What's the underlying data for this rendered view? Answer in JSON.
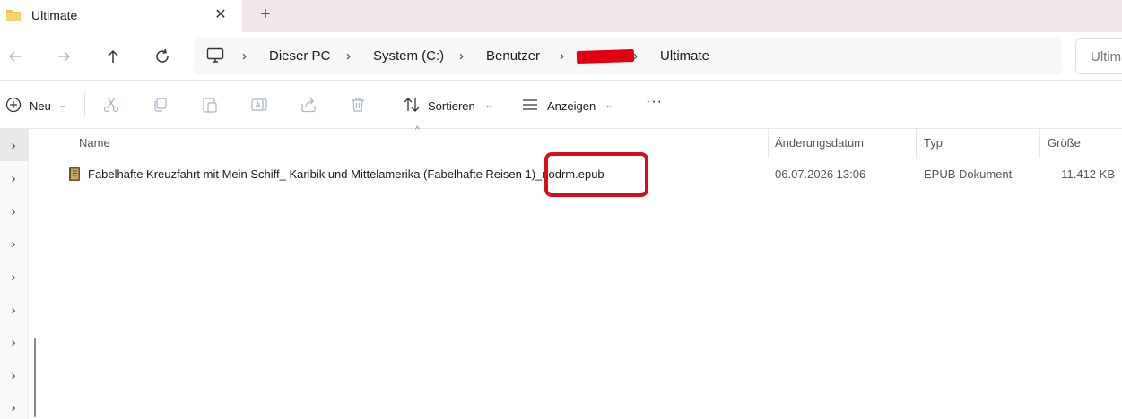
{
  "tab": {
    "title": "Ultimate",
    "close_glyph": "✕",
    "new_tab_glyph": "+"
  },
  "nav": {
    "back_icon": "arrow-left-icon",
    "forward_icon": "arrow-right-icon",
    "up_icon": "arrow-up-icon",
    "refresh_icon": "refresh-icon"
  },
  "breadcrumb": {
    "root_icon": "monitor-icon",
    "separator": "›",
    "items": [
      "Dieser PC",
      "System (C:)",
      "Benutzer",
      "",
      "Ultimate"
    ]
  },
  "search": {
    "placeholder": "Ultimate"
  },
  "toolbar": {
    "new_label": "Neu",
    "sort_label": "Sortieren",
    "view_label": "Anzeigen",
    "more_glyph": "···",
    "caret": "⌄"
  },
  "navpane": {
    "chevron": "›"
  },
  "columns": {
    "name": "Name",
    "date": "Änderungsdatum",
    "type": "Typ",
    "size": "Größe",
    "sort_indicator": "^"
  },
  "files": [
    {
      "name": "Fabelhafte Kreuzfahrt mit Mein Schiff_ Karibik und Mittelamerika (Fabelhafte Reisen 1)_nodrm.epub",
      "date": "06.07.2026 13:06",
      "type": "EPUB Dokument",
      "size": "11.412 KB",
      "icon": "epub-book-icon"
    }
  ],
  "colors": {
    "accent_red": "#d4101e",
    "redaction": "#e00010",
    "tabbar": "#f1e6ea",
    "folder": "#f2c14e"
  }
}
